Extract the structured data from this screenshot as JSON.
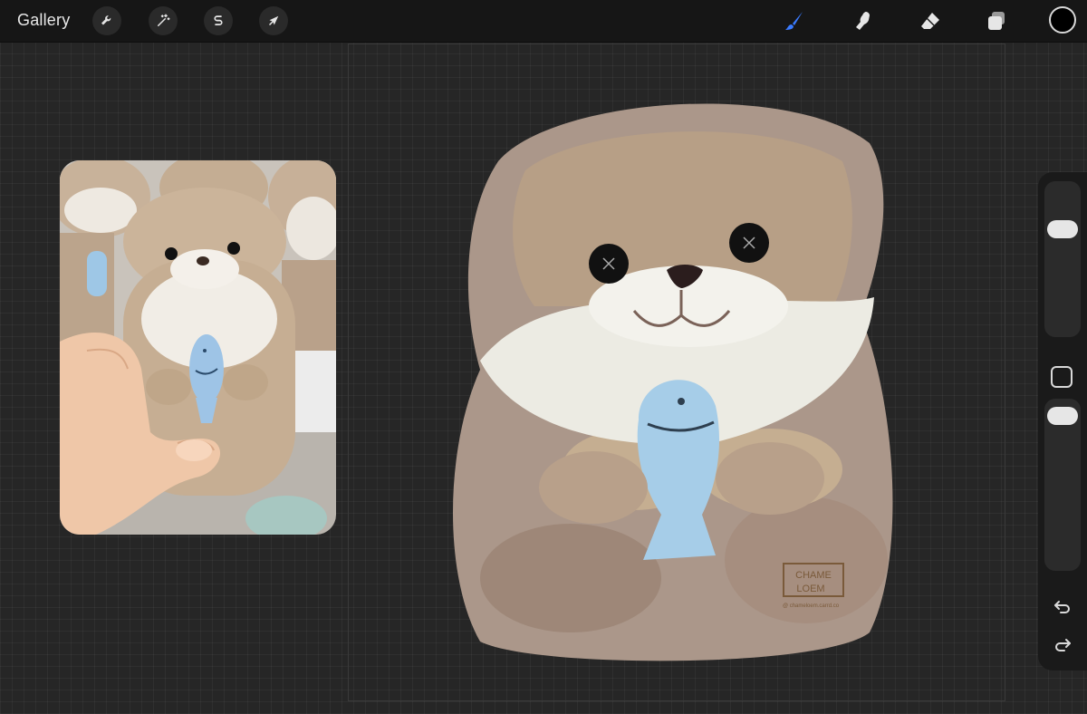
{
  "topbar": {
    "gallery_label": "Gallery",
    "tools_left": [
      {
        "name": "actions",
        "icon": "wrench-icon"
      },
      {
        "name": "adjustments",
        "icon": "magic-wand-icon"
      },
      {
        "name": "selection",
        "icon": "selection-s-icon"
      },
      {
        "name": "transform",
        "icon": "arrow-cursor-icon"
      }
    ],
    "tools_right": [
      {
        "name": "brush",
        "icon": "brush-icon",
        "active": true
      },
      {
        "name": "smudge",
        "icon": "smudge-finger-icon"
      },
      {
        "name": "eraser",
        "icon": "eraser-icon"
      },
      {
        "name": "layers",
        "icon": "layers-icon"
      }
    ],
    "current_color": "#000000",
    "active_color": "#3a7bff"
  },
  "reference": {
    "description_icon": "otter-plush-photo"
  },
  "artwork": {
    "watermark_line1": "CHAME",
    "watermark_line2": "LOEM",
    "watermark_url": "@ chameloem.carrd.co"
  },
  "sidebar": {
    "brush_size_level": 0.72,
    "opacity_level": 0.95,
    "icons": [
      "modify-icon",
      "undo-icon",
      "redo-icon"
    ]
  }
}
